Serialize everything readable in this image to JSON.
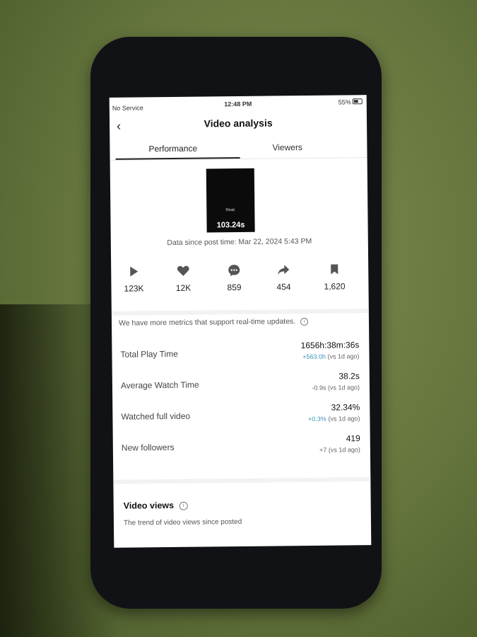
{
  "status_bar": {
    "carrier": "No Service",
    "time": "12:48 PM",
    "battery": "55%"
  },
  "header": {
    "title": "Video analysis",
    "back_icon": "chevron-left-icon"
  },
  "tabs": [
    {
      "label": "Performance",
      "active": true
    },
    {
      "label": "Viewers",
      "active": false
    }
  ],
  "video": {
    "thumb_text": "Real.",
    "duration": "103.24s",
    "since_text": "Data since post time: Mar 22, 2024 5:43 PM"
  },
  "stats": [
    {
      "icon": "play-icon",
      "value": "123K"
    },
    {
      "icon": "heart-icon",
      "value": "12K"
    },
    {
      "icon": "comment-icon",
      "value": "859"
    },
    {
      "icon": "share-icon",
      "value": "454"
    },
    {
      "icon": "bookmark-icon",
      "value": "1,620"
    }
  ],
  "note": {
    "text": "We have more metrics that support real-time updates.",
    "icon": "info-icon"
  },
  "metrics": [
    {
      "label": "Total Play Time",
      "value": "1656h:38m:36s",
      "delta": "+563.0h",
      "suffix": " (vs 1d ago)"
    },
    {
      "label": "Average Watch Time",
      "value": "38.2s",
      "delta": "-0.9s",
      "suffix": " (vs 1d ago)"
    },
    {
      "label": "Watched full video",
      "value": "32.34%",
      "delta": "+0.3%",
      "suffix": " (vs 1d ago)"
    },
    {
      "label": "New followers",
      "value": "419",
      "delta": "+7",
      "suffix": " (vs 1d ago)"
    }
  ],
  "video_views": {
    "title": "Video views",
    "subtitle": "The trend of video views since posted"
  },
  "colors": {
    "accent_positive": "#3c93b7",
    "background": "#ffffff"
  }
}
